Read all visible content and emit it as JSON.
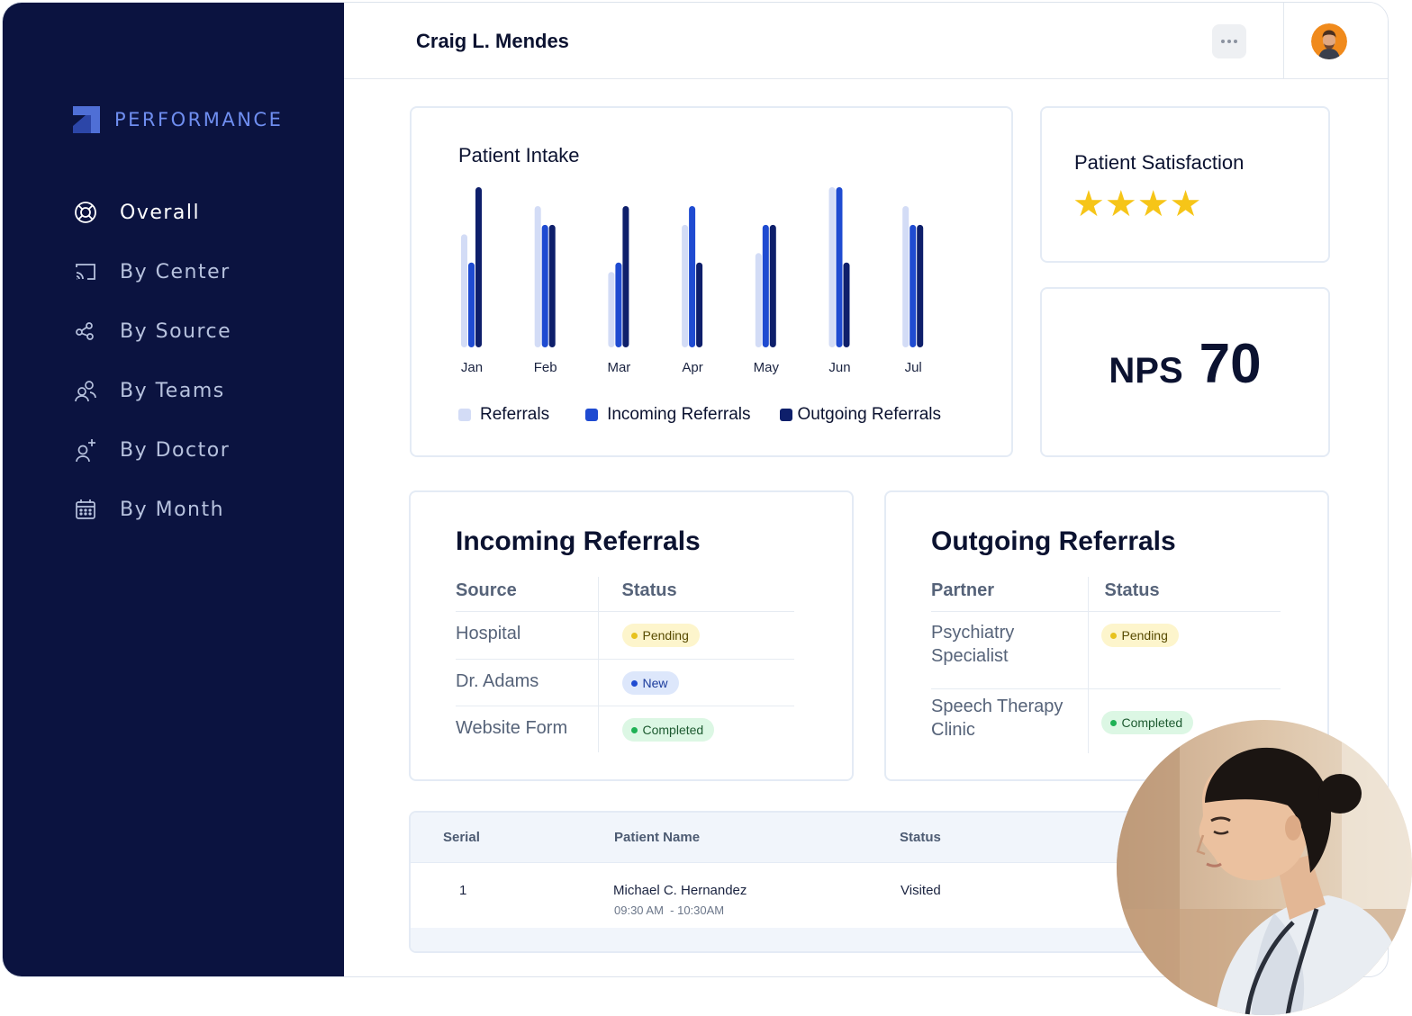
{
  "sidebar": {
    "brand": "PERFORMANCE",
    "items": [
      {
        "label": "Overall",
        "icon": "lifebuoy-icon",
        "active": true
      },
      {
        "label": "By Center",
        "icon": "cast-icon"
      },
      {
        "label": "By Source",
        "icon": "share-nodes-icon"
      },
      {
        "label": "By Teams",
        "icon": "users-icon"
      },
      {
        "label": "By Doctor",
        "icon": "user-plus-icon"
      },
      {
        "label": "By Month",
        "icon": "calendar-icon"
      }
    ]
  },
  "header": {
    "user_name": "Craig L. Mendes",
    "more_icon": "more-horizontal-icon"
  },
  "patient_intake": {
    "title": "Patient Intake",
    "legend": [
      "Referrals",
      "Incoming Referrals",
      "Outgoing Referrals"
    ]
  },
  "chart_data": {
    "type": "bar",
    "title": "Patient Intake",
    "categories": [
      "Jan",
      "Feb",
      "Mar",
      "Apr",
      "May",
      "Jun",
      "Jul"
    ],
    "series": [
      {
        "name": "Referrals",
        "color": "#d3dcf6",
        "values": [
          60,
          75,
          40,
          65,
          50,
          85,
          75
        ]
      },
      {
        "name": "Incoming Referrals",
        "color": "#1f4bd1",
        "values": [
          45,
          65,
          45,
          75,
          65,
          85,
          65
        ]
      },
      {
        "name": "Outgoing Referrals",
        "color": "#0e1f6b",
        "values": [
          85,
          65,
          75,
          45,
          65,
          45,
          65
        ]
      }
    ],
    "ylim": [
      0,
      85
    ],
    "grid": false,
    "legend_position": "bottom"
  },
  "satisfaction": {
    "title": "Patient Satisfaction",
    "stars": "★★★★",
    "rating": 4
  },
  "nps": {
    "label": "NPS",
    "value": "70"
  },
  "incoming": {
    "title": "Incoming Referrals",
    "col1": "Source",
    "col2": "Status",
    "rows": [
      {
        "name": "Hospital",
        "status": "Pending",
        "type": "pending"
      },
      {
        "name": "Dr. Adams",
        "status": "New",
        "type": "new"
      },
      {
        "name": "Website Form",
        "status": "Completed",
        "type": "completed"
      }
    ]
  },
  "outgoing": {
    "title": "Outgoing Referrals",
    "col1": "Partner",
    "col2": "Status",
    "rows": [
      {
        "name": "Psychiatry Specialist",
        "status": "Pending",
        "type": "pending"
      },
      {
        "name": "Speech Therapy Clinic",
        "status": "Completed",
        "type": "completed"
      }
    ]
  },
  "patients": {
    "headers": [
      "Serial",
      "Patient Name",
      "Status"
    ],
    "rows": [
      {
        "serial": "1",
        "name": "Michael C. Hernandez",
        "time": "09:30 AM  - 10:30AM",
        "status": "Visited"
      }
    ]
  },
  "colors": {
    "sidebar_bg": "#0b1340",
    "brand_accent": "#6f8ef0",
    "star": "#f6c518"
  }
}
